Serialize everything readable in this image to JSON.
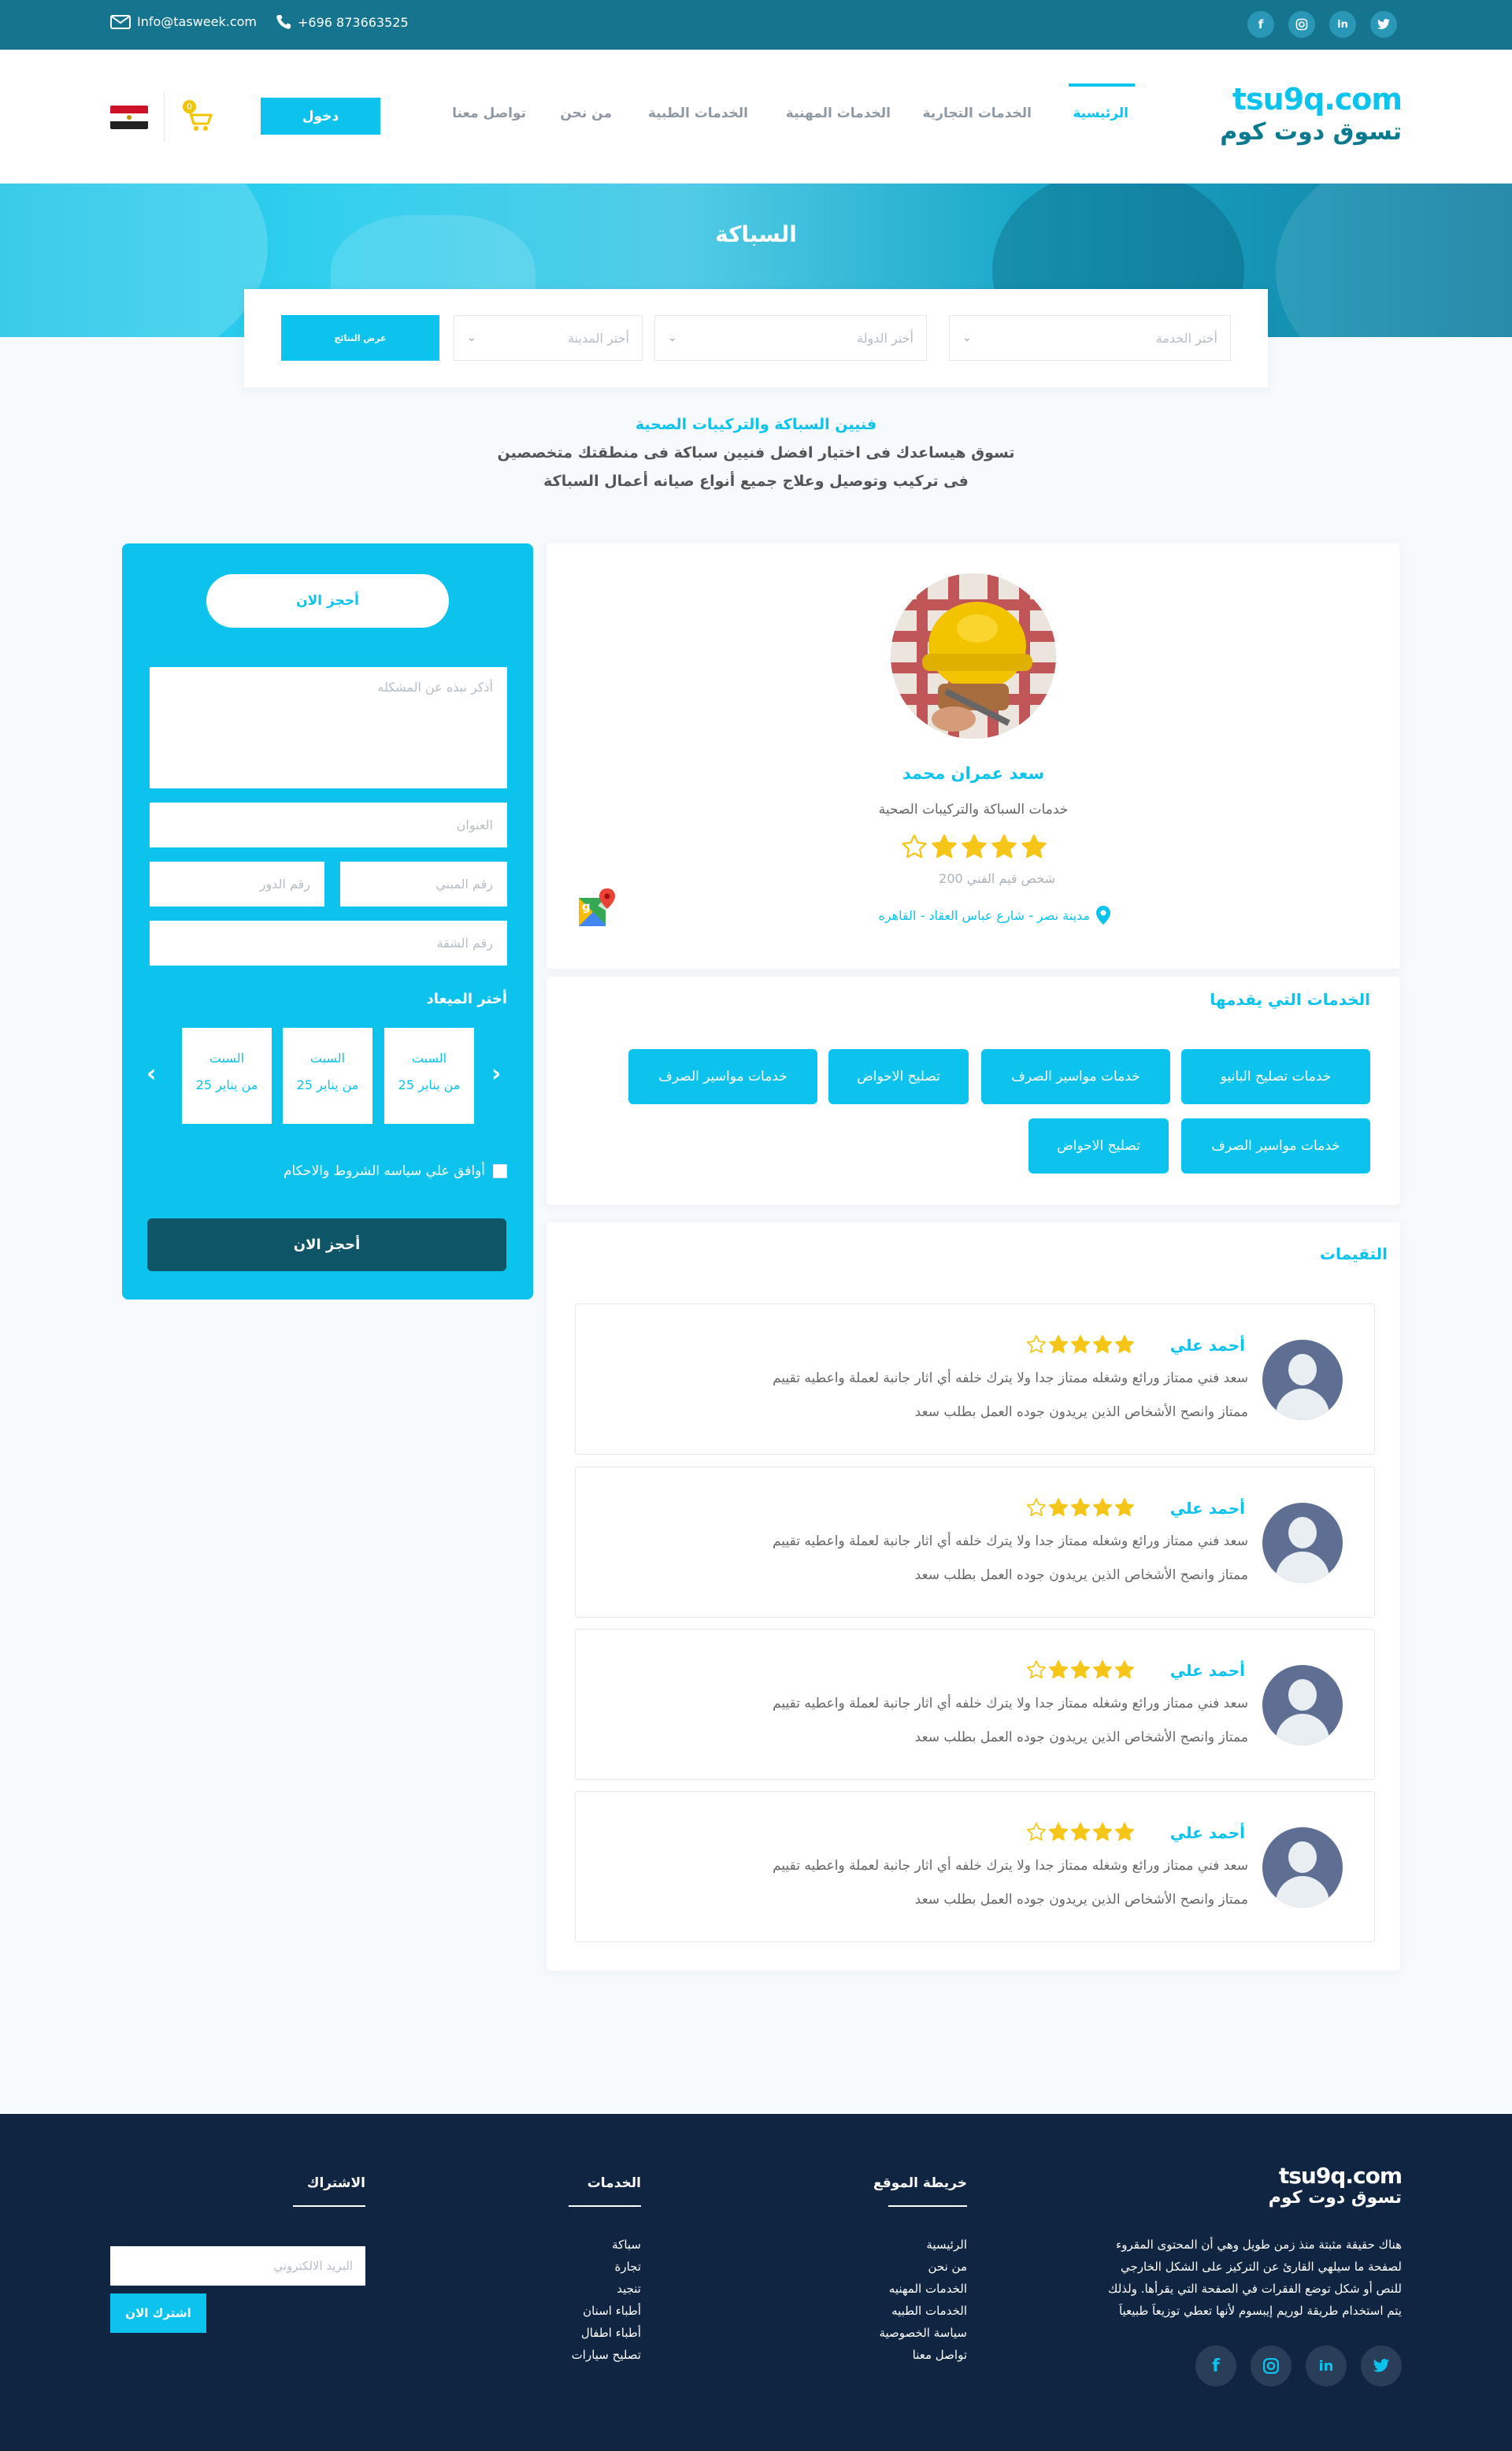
{
  "topbar": {
    "email": "Info@tasweek.com",
    "phone": "+696 873663525",
    "social": [
      "twitter-icon",
      "linkedin-icon",
      "instagram-icon",
      "facebook-icon"
    ]
  },
  "header": {
    "logo_en": "tsu9q.com",
    "logo_ar": "تسوق دوت كوم",
    "nav": [
      "الرئيسية",
      "الخدمات التجارية",
      "الخدمات المهنية",
      "الخدمات الطبية",
      "من نحن",
      "تواصل معنا"
    ],
    "login": "دخول",
    "cart_count": "0",
    "accent": "#0cc3ee"
  },
  "hero": {
    "title": "السباكة"
  },
  "search": {
    "service_placeholder": "أختر الخدمة",
    "country_placeholder": "أختر الدولة",
    "city_placeholder": "أختر المدينة",
    "submit": "عرض النتائج"
  },
  "intro": {
    "title": "فنيين السباكة والتركيبات الصحية",
    "line1": "تسوق هيساعدك فى اختيار افضل فنيين سباكة فى منطقتك متخصصين",
    "line2": "فى تركيب وتوصيل وعلاج جميع أنواع صيانه أعمال السباكة"
  },
  "profile": {
    "name": "سعد عمران محمد",
    "title": "خدمات السباكة والتركيبات الصحية",
    "rating": 4,
    "rating_out_of": 5,
    "ratings_label": "شخص قيم الفني",
    "ratings_count": "200",
    "address": "مدينة نصر - شارع عباس العقاد - القاهره"
  },
  "services": {
    "title": "الخدمات التي يقدمها",
    "items": [
      "خدمات تصليح البانيو",
      "خدمات مواسير الصرف",
      "تصليح الاحواض",
      "خدمات مواسير الصرف",
      "خدمات مواسير الصرف",
      "تصليح الاحواض"
    ]
  },
  "reviews": {
    "title": "التقيمات",
    "items": [
      {
        "name": "أحمد علي",
        "rating": 4,
        "line1": "سعد فني ممتاز ورائع وشغله ممتاز جدا ولا يترك خلفه أي اثار جانبة لعملة واعطيه تقييم",
        "line2": "ممتاز وانصح الأشخاص الذين يريدون جوده العمل بطلب سعد"
      },
      {
        "name": "أحمد علي",
        "rating": 4,
        "line1": "سعد فني ممتاز ورائع وشغله ممتاز جدا ولا يترك خلفه أي اثار جانبة لعملة واعطيه تقييم",
        "line2": "ممتاز وانصح الأشخاص الذين يريدون جوده العمل بطلب سعد"
      },
      {
        "name": "أحمد علي",
        "rating": 4,
        "line1": "سعد فني ممتاز ورائع وشغله ممتاز جدا ولا يترك خلفه أي اثار جانبة لعملة واعطيه تقييم",
        "line2": "ممتاز وانصح الأشخاص الذين يريدون جوده العمل بطلب سعد"
      },
      {
        "name": "أحمد علي",
        "rating": 4,
        "line1": "سعد فني ممتاز ورائع وشغله ممتاز جدا ولا يترك خلفه أي اثار جانبة لعملة واعطيه تقييم",
        "line2": "ممتاز وانصح الأشخاص الذين يريدون جوده العمل بطلب سعد"
      }
    ]
  },
  "booking": {
    "top_button": "أحجز الان",
    "problem_placeholder": "أذكر نبذه عن المشكله",
    "address_placeholder": "العنوان",
    "building_placeholder": "رقم المبني",
    "floor_placeholder": "رقم الدور",
    "apartment_placeholder": "رقم الشقة",
    "date_title": "أختر الميعاد",
    "dates": [
      {
        "day": "السبت",
        "date": "من يناير 25"
      },
      {
        "day": "السبت",
        "date": "من يناير 25"
      },
      {
        "day": "السبت",
        "date": "من يناير 25"
      }
    ],
    "terms": "أوافق علي سياسه الشروط والاحكام",
    "submit": "أحجز الان"
  },
  "footer": {
    "about": [
      "هناك حقيقة مثبتة منذ زمن طويل وهي أن المحتوى المقروء",
      "لصفحة ما سيلهي القارئ عن التركيز على الشكل الخارجي",
      "للنص أو شكل توضع الفقرات في الصفحة التي يقرأها. ولذلك",
      "يتم استخدام طريقة لوريم إيبسوم لأنها تعطي توزيعاَ طبيعياَ"
    ],
    "sitemap_title": "خريطة الموقع",
    "sitemap": [
      "الرئيسية",
      "من نحن",
      "الخدمات المهنيه",
      "الخدمات الطبيه",
      "سياسة الخصوصية",
      "تواصل معنا"
    ],
    "services_title": "الخدمات",
    "services": [
      "سباكة",
      "تجارة",
      "تنجيد",
      "أطباء اسنان",
      "أطباء اطفال",
      "تصليح سيارات"
    ],
    "subscribe_title": "الاشتراك",
    "email_placeholder": "البريد الالكتروني",
    "subscribe_button": "اشترك الان"
  }
}
